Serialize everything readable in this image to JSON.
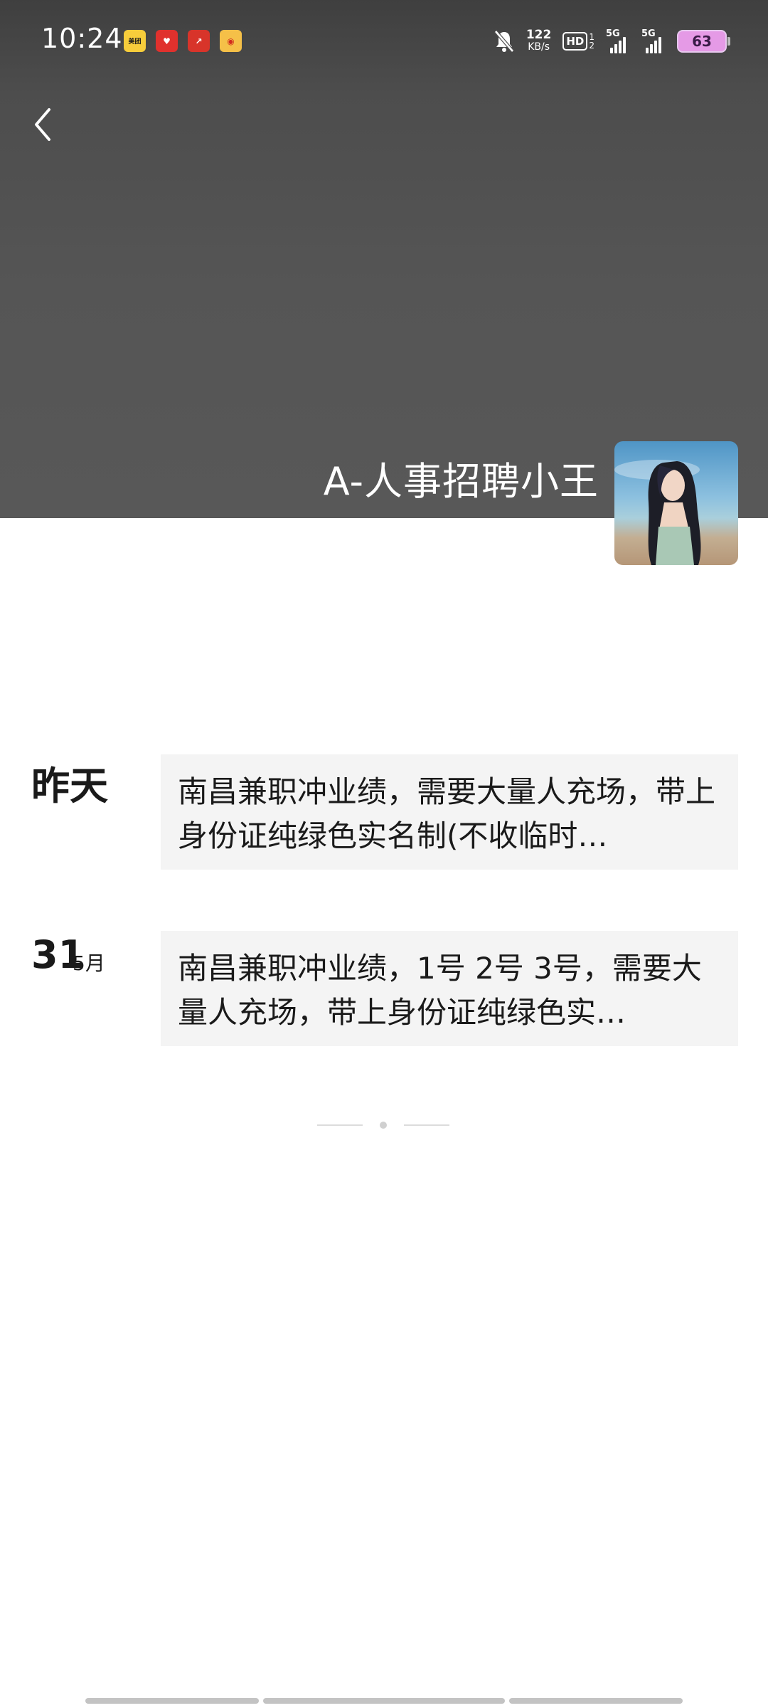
{
  "status_bar": {
    "time": "10:24",
    "notification_apps": [
      {
        "name": "meituan-icon",
        "glyph": "美团"
      },
      {
        "name": "app-heart-icon",
        "glyph": "♥"
      },
      {
        "name": "app-arrow-icon",
        "glyph": "↗"
      },
      {
        "name": "weibo-icon",
        "glyph": "◉"
      }
    ],
    "net_speed_value": "122",
    "net_speed_unit": "KB/s",
    "hd_label": "HD",
    "hd_sub_top": "1",
    "hd_sub_bottom": "2",
    "sim1_network": "5G",
    "sim2_network": "5G",
    "battery_level": "63"
  },
  "header": {
    "profile_name": "A-人事招聘小王"
  },
  "posts": [
    {
      "date_label": "昨天",
      "text": "南昌兼职冲业绩，需要大量人充场，带上身份证纯绿色实名制(不收临时…"
    },
    {
      "day": "31",
      "month": "5月",
      "text": "南昌兼职冲业绩，1号 2号 3号，需要大量人充场，带上身份证纯绿色实…"
    }
  ]
}
